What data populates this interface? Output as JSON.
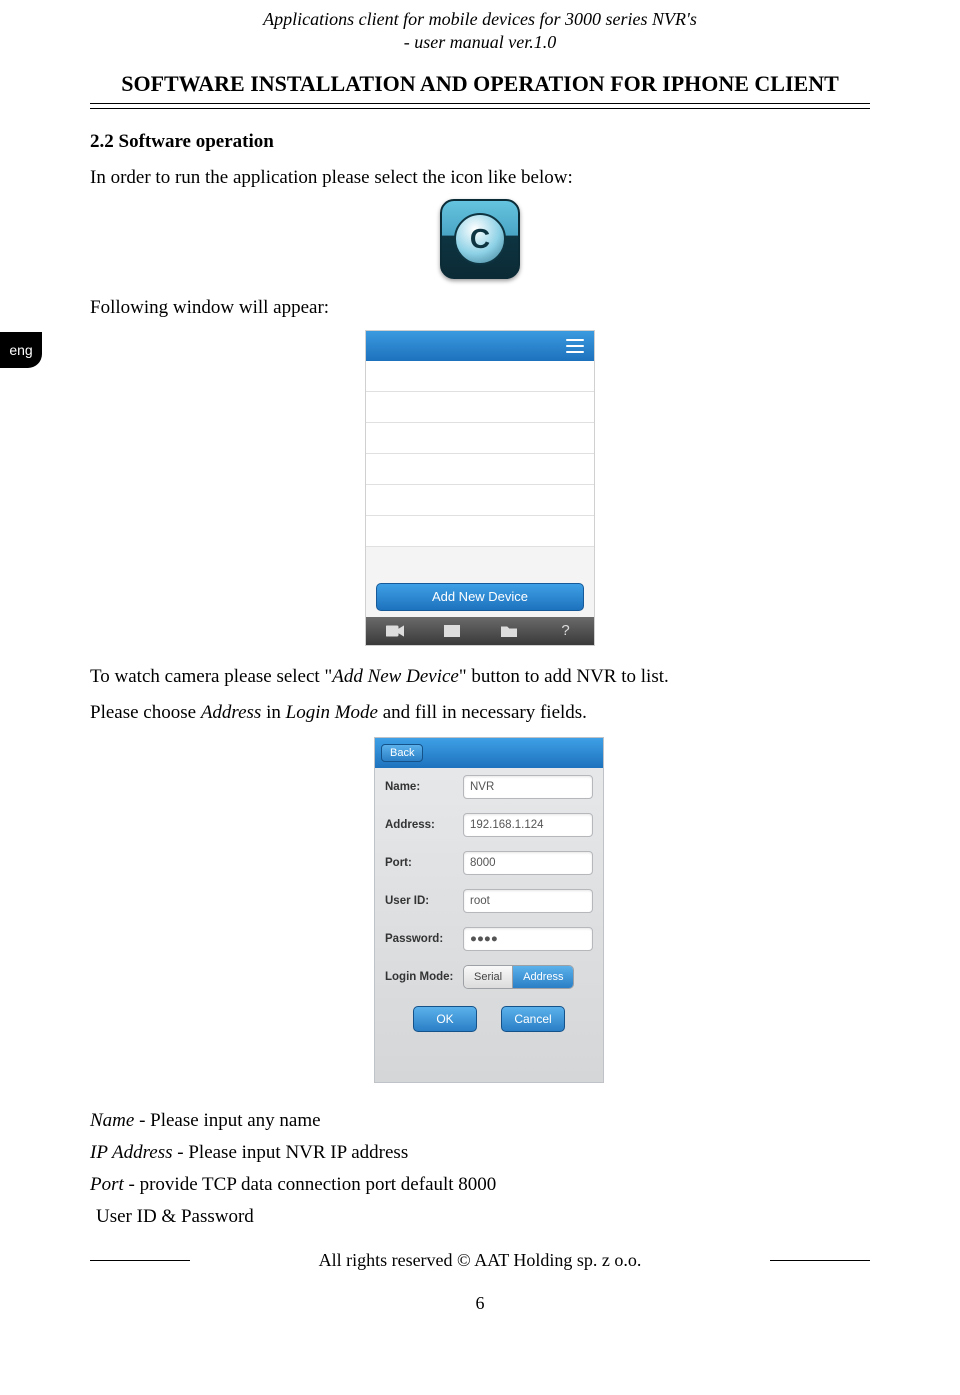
{
  "header": {
    "line1": "Applications client for mobile devices for 3000 series NVR's",
    "line2": "- user manual ver.1.0"
  },
  "chapter_title": "SOFTWARE INSTALLATION AND OPERATION FOR IPHONE CLIENT",
  "lang_tab": "eng",
  "section": {
    "title": "2.2 Software operation",
    "intro": "In order to run the application please select the icon like below:",
    "following": "Following window will appear:",
    "watch_pre": "To watch camera please select \"",
    "watch_em": "Add New Device",
    "watch_post": "\" button to add NVR to list.",
    "choose_pre": "Please choose ",
    "choose_em1": "Address",
    "choose_mid": " in ",
    "choose_em2": "Login Mode",
    "choose_post": " and fill in necessary fields."
  },
  "app_icon": {
    "glyph": "C"
  },
  "device_list": {
    "add_button": "Add New Device",
    "toolbar_items": [
      "video",
      "keypad",
      "folder",
      "help"
    ]
  },
  "form": {
    "back": "Back",
    "rows": {
      "name": {
        "label": "Name:",
        "value": "NVR"
      },
      "address": {
        "label": "Address:",
        "value": "192.168.1.124"
      },
      "port": {
        "label": "Port:",
        "value": "8000"
      },
      "user": {
        "label": "User ID:",
        "value": "root"
      },
      "password": {
        "label": "Password:",
        "value": "●●●●"
      },
      "login_mode": {
        "label": "Login Mode:",
        "options": [
          "Serial",
          "Address"
        ],
        "selected": "Address"
      }
    },
    "buttons": {
      "ok": "OK",
      "cancel": "Cancel"
    }
  },
  "field_list": {
    "name_em": "Name",
    "name_desc": " - Please input any name",
    "ip_em": "IP Address",
    "ip_desc": " - Please input NVR IP address",
    "port_em": "Port",
    "port_desc": " - provide TCP data connection port default 8000",
    "userpw": "User ID & Password"
  },
  "footer": "All rights reserved © AAT Holding sp. z o.o.",
  "page_number": "6"
}
